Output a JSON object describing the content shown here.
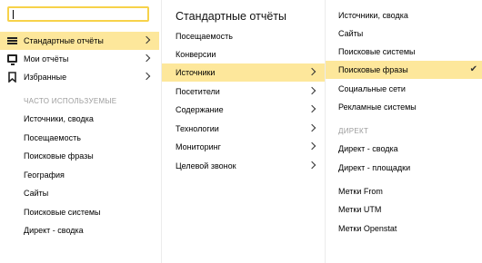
{
  "search": {
    "value": "",
    "placeholder": ""
  },
  "col1": {
    "main_items": [
      {
        "label": "Стандартные отчёты",
        "icon": "list-icon",
        "active": true,
        "has_arrow": true
      },
      {
        "label": "Мои отчёты",
        "icon": "monitor-icon",
        "active": false,
        "has_arrow": true
      },
      {
        "label": "Избранные",
        "icon": "bookmark-icon",
        "active": false,
        "has_arrow": true
      }
    ],
    "frequent_label": "ЧАСТО ИСПОЛЬЗУЕМЫЕ",
    "frequent_items": [
      "Источники, сводка",
      "Посещаемость",
      "Поисковые фразы",
      "География",
      "Сайты",
      "Поисковые системы",
      "Директ - сводка"
    ]
  },
  "col2": {
    "title": "Стандартные отчёты",
    "items": [
      {
        "label": "Посещаемость",
        "has_arrow": false,
        "active": false
      },
      {
        "label": "Конверсии",
        "has_arrow": false,
        "active": false
      },
      {
        "label": "Источники",
        "has_arrow": true,
        "active": true
      },
      {
        "label": "Посетители",
        "has_arrow": true,
        "active": false
      },
      {
        "label": "Содержание",
        "has_arrow": true,
        "active": false
      },
      {
        "label": "Технологии",
        "has_arrow": true,
        "active": false
      },
      {
        "label": "Мониторинг",
        "has_arrow": true,
        "active": false
      },
      {
        "label": "Целевой звонок",
        "has_arrow": true,
        "active": false
      }
    ]
  },
  "col3": {
    "items": [
      {
        "label": "Источники, сводка",
        "active": false
      },
      {
        "label": "Сайты",
        "active": false
      },
      {
        "label": "Поисковые системы",
        "active": false
      },
      {
        "label": "Поисковые фразы",
        "active": true,
        "checked": true
      },
      {
        "label": "Социальные сети",
        "active": false
      },
      {
        "label": "Рекламные системы",
        "active": false
      }
    ],
    "direct_label": "ДИРЕКТ",
    "direct_items": [
      "Директ - сводка",
      "Директ - площадки"
    ],
    "tag_items": [
      "Метки From",
      "Метки UTM",
      "Метки Openstat"
    ]
  },
  "colors": {
    "highlight": "#fde79b",
    "search_border": "#f7d24a",
    "section_label": "#9c9c9c"
  }
}
